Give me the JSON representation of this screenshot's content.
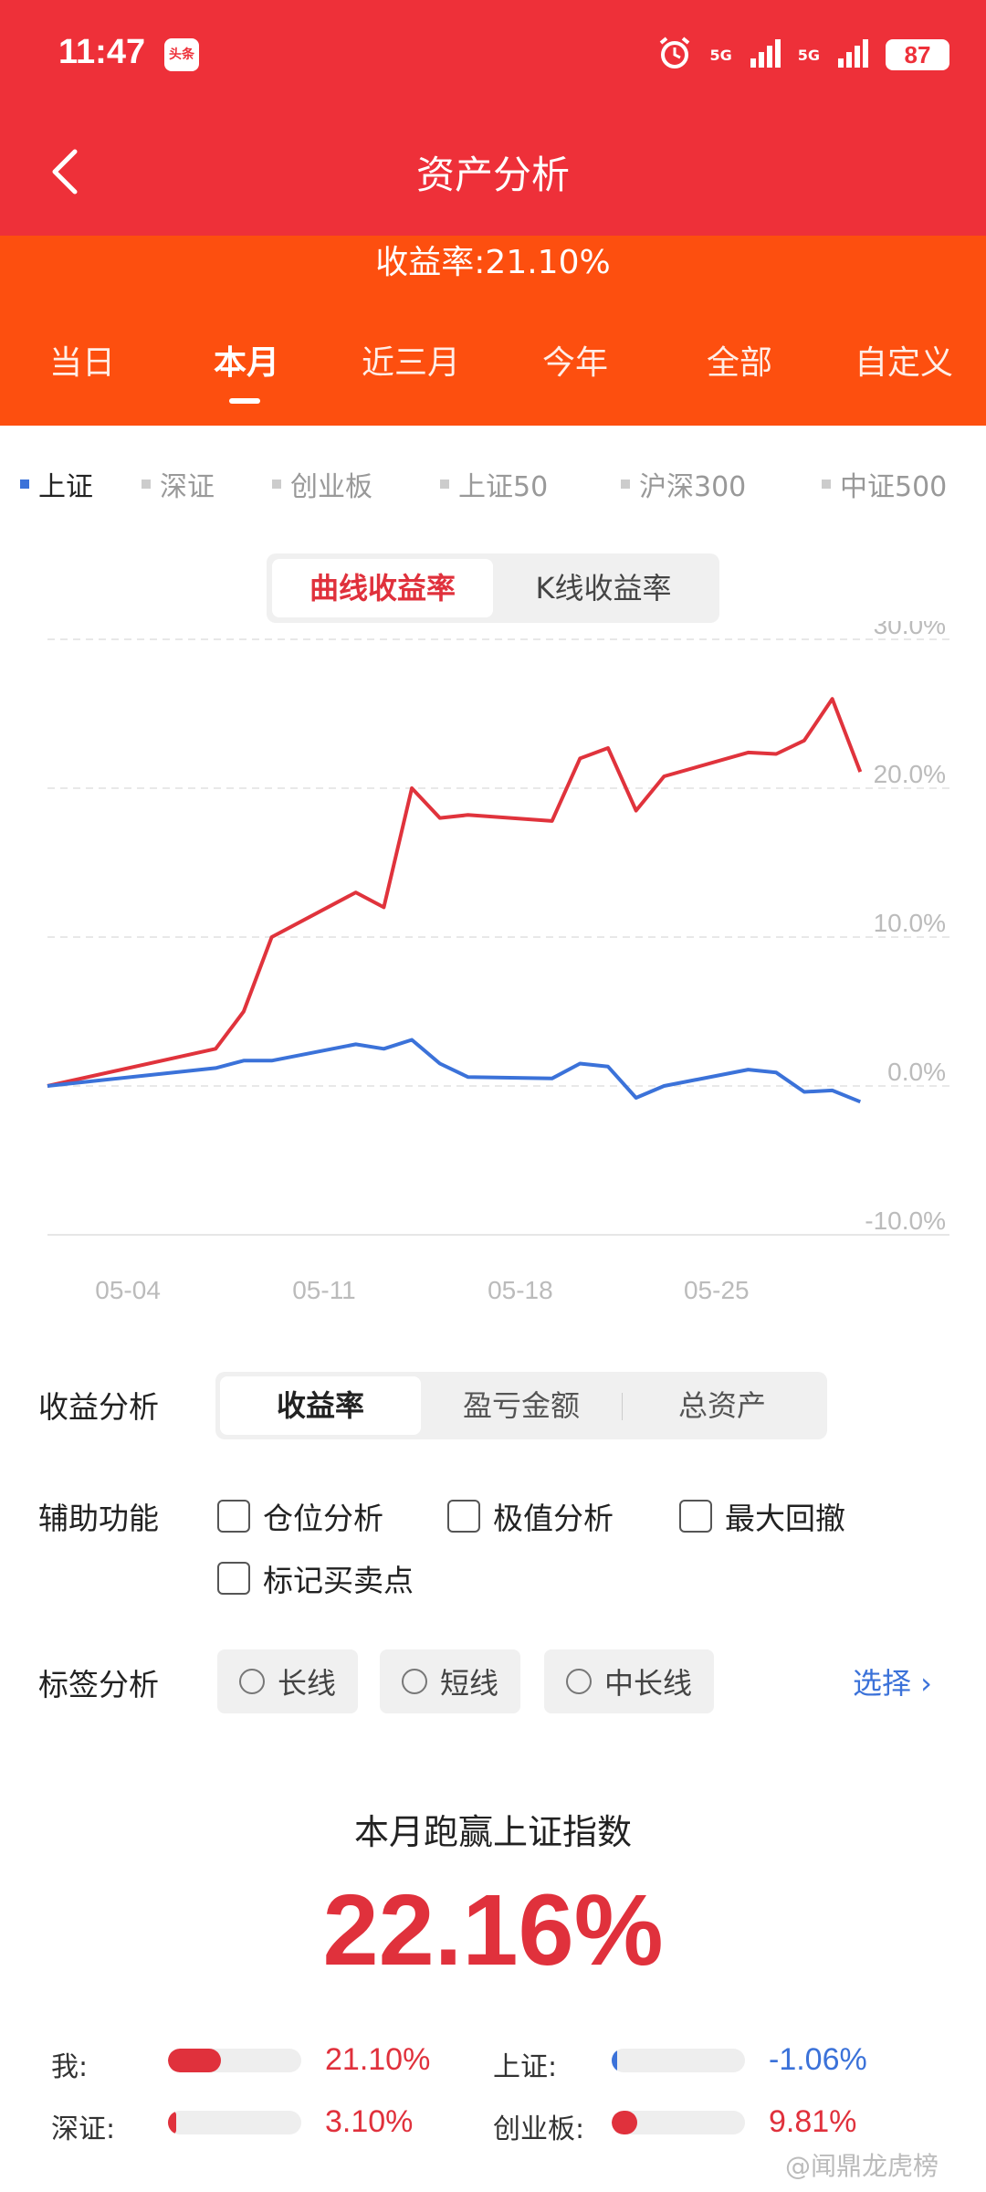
{
  "status_bar": {
    "time": "11:47",
    "app_badge": "头条",
    "battery": "87",
    "signal1": "5G",
    "signal2": "5G"
  },
  "header": {
    "title": "资产分析",
    "yield_text": "收益率:21.10%"
  },
  "period_tabs": [
    {
      "label": "当日",
      "active": false
    },
    {
      "label": "本月",
      "active": true
    },
    {
      "label": "近三月",
      "active": false
    },
    {
      "label": "今年",
      "active": false
    },
    {
      "label": "全部",
      "active": false
    },
    {
      "label": "自定义",
      "active": false
    }
  ],
  "index_options": [
    {
      "label": "上证",
      "active": true
    },
    {
      "label": "深证",
      "active": false
    },
    {
      "label": "创业板",
      "active": false
    },
    {
      "label": "上证50",
      "active": false
    },
    {
      "label": "沪深300",
      "active": false
    },
    {
      "label": "中证500",
      "active": false
    }
  ],
  "chart_mode": {
    "options": [
      "曲线收益率",
      "K线收益率"
    ],
    "active": 0
  },
  "chart_data": {
    "type": "line",
    "x_ticks": [
      "05-04",
      "05-11",
      "05-18",
      "05-25"
    ],
    "y_ticks": [
      "30.0%",
      "20.0%",
      "10.0%",
      "0.0%",
      "-10.0%"
    ],
    "ylim": [
      -10,
      30
    ],
    "series": [
      {
        "color": "#e0333c",
        "x": [
          0,
          6,
          7,
          8,
          11,
          12,
          13,
          14,
          15,
          18,
          19,
          20,
          21,
          22,
          25,
          26,
          27,
          28,
          29
        ],
        "values": [
          0,
          2.5,
          5,
          10,
          13,
          12,
          20,
          18,
          18.2,
          17.8,
          22,
          22.7,
          18.5,
          20.8,
          22.4,
          22.3,
          23.2,
          26,
          21.1
        ]
      },
      {
        "color": "#3b72d9",
        "x": [
          0,
          6,
          7,
          8,
          11,
          12,
          13,
          14,
          15,
          18,
          19,
          20,
          21,
          22,
          25,
          26,
          27,
          28,
          29
        ],
        "values": [
          0,
          1.2,
          1.7,
          1.7,
          2.8,
          2.5,
          3.1,
          1.5,
          0.6,
          0.5,
          1.5,
          1.3,
          -0.8,
          0,
          1.1,
          0.9,
          -0.4,
          -0.3,
          -1.06
        ]
      }
    ]
  },
  "analysis": {
    "label": "收益分析",
    "options": [
      "收益率",
      "盈亏金额",
      "总资产"
    ],
    "active": 0
  },
  "aux": {
    "label": "辅助功能",
    "options": [
      "仓位分析",
      "极值分析",
      "最大回撤",
      "标记买卖点"
    ]
  },
  "tags": {
    "label": "标签分析",
    "options": [
      "长线",
      "短线",
      "中长线"
    ],
    "select_label": "选择 ›"
  },
  "beat": {
    "title": "本月跑赢上证指数",
    "value": "22.16%"
  },
  "compare": [
    {
      "label": "我:",
      "value": "21.10%",
      "fraction": 0.4,
      "color": "#e0313c"
    },
    {
      "label": "上证:",
      "value": "-1.06%",
      "fraction": 0.03,
      "color": "#3b72d9"
    },
    {
      "label": "深证:",
      "value": "3.10%",
      "fraction": 0.06,
      "color": "#e0313c"
    },
    {
      "label": "创业板:",
      "value": "9.81%",
      "fraction": 0.19,
      "color": "#e0313c"
    }
  ],
  "watermark": "@闻鼎龙虎榜"
}
